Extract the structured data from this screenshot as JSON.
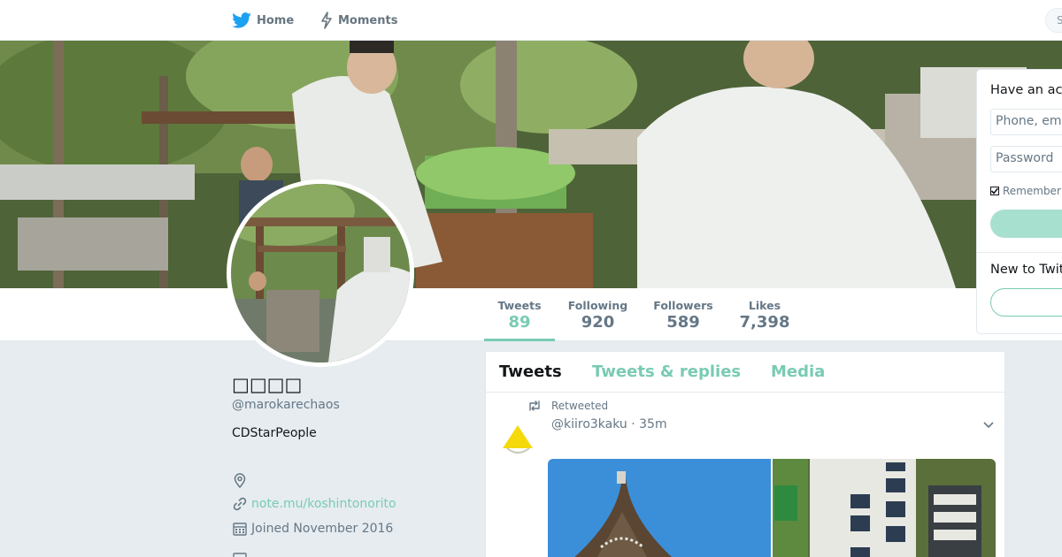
{
  "nav": {
    "home_label": "Home",
    "moments_label": "Moments",
    "search_stub": "S"
  },
  "profile": {
    "name": "□□□□",
    "handle": "@marokarechaos",
    "bio": "CDStarPeople",
    "location": "",
    "url": "note.mu/koshintonorito",
    "joined": "Joined November 2016"
  },
  "stats": {
    "tweets": {
      "label": "Tweets",
      "value": "89"
    },
    "following": {
      "label": "Following",
      "value": "920"
    },
    "followers": {
      "label": "Followers",
      "value": "589"
    },
    "likes": {
      "label": "Likes",
      "value": "7,398"
    }
  },
  "timeline": {
    "tabs": [
      "Tweets",
      "Tweets & replies",
      "Media"
    ],
    "active_tab": "Tweets",
    "tweet": {
      "retweet_label": "Retweeted",
      "header": "@kiiro3kaku · 35m"
    }
  },
  "login": {
    "title": "Have an account?",
    "phone_placeholder": "Phone, email or username",
    "password_placeholder": "Password",
    "remember_label": "Remember me",
    "new_to": "New to Twitter?"
  },
  "colors": {
    "accent": "#79cbb3",
    "background": "#e6ecf0",
    "muted_text": "#657786"
  }
}
